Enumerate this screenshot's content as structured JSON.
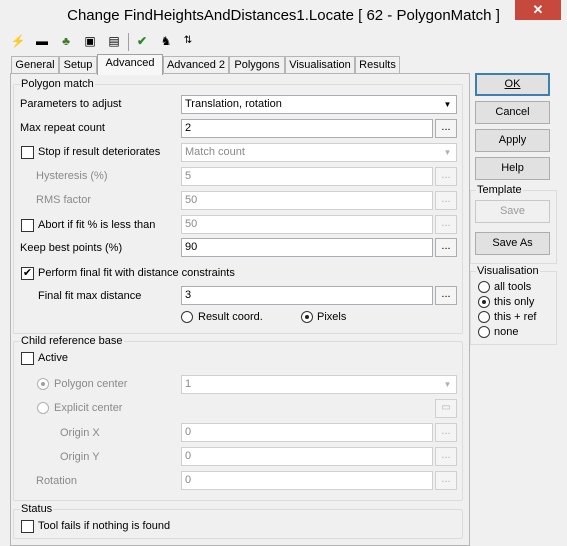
{
  "window": {
    "title": "Change FindHeightsAndDistances1.Locate [ 62 - PolygonMatch ]",
    "close_glyph": "✕"
  },
  "toolbar": {
    "icons": [
      "lightning-icon",
      "link-icon",
      "frog-icon",
      "console-icon",
      "document-icon",
      "check-icon",
      "person-icon",
      "sort-icon"
    ]
  },
  "tabs": [
    "General",
    "Setup",
    "Advanced",
    "Advanced 2",
    "Polygons",
    "Visualisation",
    "Results"
  ],
  "polygon_match": {
    "legend": "Polygon match",
    "params_label": "Parameters to adjust",
    "params_value": "Translation, rotation",
    "max_repeat_label": "Max repeat count",
    "max_repeat_value": "2",
    "stop_label": "Stop if result deteriorates",
    "stop_value": "Match count",
    "hysteresis_label": "Hysteresis (%)",
    "hysteresis_value": "5",
    "rms_label": "RMS factor",
    "rms_value": "50",
    "abort_label": "Abort if fit % is less than",
    "abort_value": "50",
    "keep_best_label": "Keep best points (%)",
    "keep_best_value": "90",
    "final_fit_label": "Perform final fit with distance constraints",
    "final_fit_checked": "✔",
    "final_fit_max_label": "Final fit max distance",
    "final_fit_max_value": "3",
    "result_coord_label": "Result coord.",
    "pixels_label": "Pixels",
    "ellipsis": "..."
  },
  "child_ref": {
    "legend": "Child reference base",
    "active_label": "Active",
    "polygon_center_label": "Polygon center",
    "polygon_center_value": "1",
    "explicit_center_label": "Explicit center",
    "origin_x_label": "Origin X",
    "origin_x_value": "0",
    "origin_y_label": "Origin Y",
    "origin_y_value": "0",
    "rotation_label": "Rotation",
    "rotation_value": "0"
  },
  "status": {
    "legend": "Status",
    "fails_label": "Tool fails if nothing is found"
  },
  "buttons": {
    "ok": "OK",
    "cancel": "Cancel",
    "apply": "Apply",
    "help": "Help"
  },
  "template": {
    "legend": "Template",
    "save": "Save",
    "save_as": "Save As"
  },
  "visualisation": {
    "legend": "Visualisation",
    "options": [
      "all tools",
      "this only",
      "this + ref",
      "none"
    ]
  }
}
